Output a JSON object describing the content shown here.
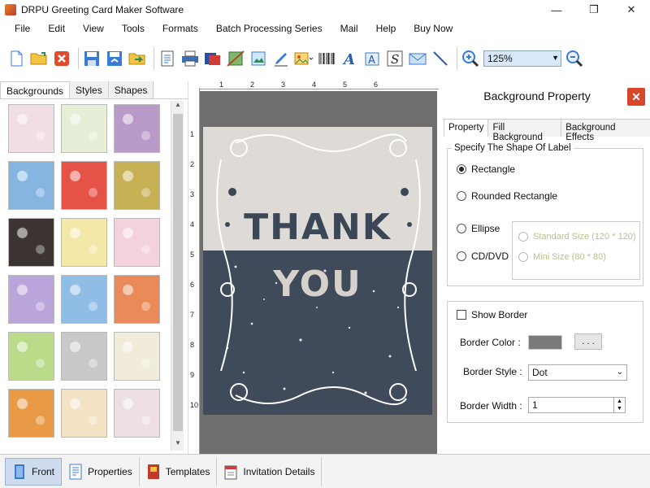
{
  "window": {
    "title": "DRPU Greeting Card Maker Software",
    "minimize": "—",
    "maximize": "❐",
    "close": "✕"
  },
  "menu": [
    "File",
    "Edit",
    "View",
    "Tools",
    "Formats",
    "Batch Processing Series",
    "Mail",
    "Help",
    "Buy Now"
  ],
  "toolbar": {
    "zoom_value": "125%",
    "icons": [
      "new-icon",
      "open-icon",
      "close-doc-icon",
      "save-icon",
      "save-as-icon",
      "export-icon",
      "page-setup-icon",
      "print-icon",
      "print-preview-icon",
      "image-icon",
      "insert-image-icon",
      "pen-icon",
      "picture-icon",
      "barcode-icon",
      "text-art-icon",
      "text-icon",
      "font-icon",
      "signature-icon",
      "mail-icon",
      "line-icon",
      "zoom-in-icon",
      "zoom-out-icon"
    ]
  },
  "left_panel": {
    "tabs": [
      "Backgrounds",
      "Styles",
      "Shapes"
    ],
    "active_tab": "Backgrounds",
    "thumbnails": [
      {
        "name": "bg-pink-butterflies",
        "color": "#f1dde4"
      },
      {
        "name": "bg-green-leaves",
        "color": "#e6eed8"
      },
      {
        "name": "bg-purple-flowers",
        "color": "#b99ac9"
      },
      {
        "name": "bg-blue-sky",
        "color": "#86b5e2"
      },
      {
        "name": "bg-strawberries",
        "color": "#e55246"
      },
      {
        "name": "bg-autumn-leaves",
        "color": "#c7b154"
      },
      {
        "name": "bg-dark-roses",
        "color": "#3b3430"
      },
      {
        "name": "bg-colorful-dots",
        "color": "#f3e8a8"
      },
      {
        "name": "bg-gift-boxes",
        "color": "#f3d2de"
      },
      {
        "name": "bg-floral-mandala",
        "color": "#b9a5d9"
      },
      {
        "name": "bg-snowflakes",
        "color": "#8fbde6"
      },
      {
        "name": "bg-orange-circles",
        "color": "#e98a58"
      },
      {
        "name": "bg-christmas-trees",
        "color": "#b9db8a"
      },
      {
        "name": "bg-gray-heart",
        "color": "#c9c9c9"
      },
      {
        "name": "bg-candies",
        "color": "#f0ecd9"
      },
      {
        "name": "bg-flowers-orange",
        "color": "#e99a46"
      },
      {
        "name": "bg-teddy-card",
        "color": "#f3e3c4"
      },
      {
        "name": "bg-light-floral",
        "color": "#eee0e2"
      }
    ]
  },
  "rulers": {
    "top": [
      "1",
      "2",
      "3",
      "4",
      "5",
      "6"
    ],
    "left": [
      "1",
      "2",
      "3",
      "4",
      "5",
      "6",
      "7",
      "8",
      "9",
      "10"
    ]
  },
  "card": {
    "line1": "THANK",
    "line2": "YOU"
  },
  "right_panel": {
    "title": "Background Property",
    "tabs": [
      "Property",
      "Fill Background",
      "Background Effects"
    ],
    "active_tab": "Property",
    "shape_group_label": "Specify The Shape Of Label",
    "shapes": {
      "rectangle": "Rectangle",
      "rounded_rectangle": "Rounded Rectangle",
      "ellipse": "Ellipse",
      "cd_dvd": "CD/DVD",
      "standard_size": "Standard Size (120 * 120)",
      "mini_size": "Mini Size (80 * 80)"
    },
    "selected_shape": "Rectangle",
    "show_border_label": "Show Border",
    "show_border_checked": false,
    "border_color_label": "Border Color :",
    "border_color": "#7a7a7a",
    "border_color_button": ". . .",
    "border_style_label": "Border Style :",
    "border_style_value": "Dot",
    "border_width_label": "Border Width :",
    "border_width_value": "1"
  },
  "bottom_bar": {
    "buttons": [
      "Front",
      "Properties",
      "Templates",
      "Invitation Details"
    ],
    "active": "Front"
  }
}
